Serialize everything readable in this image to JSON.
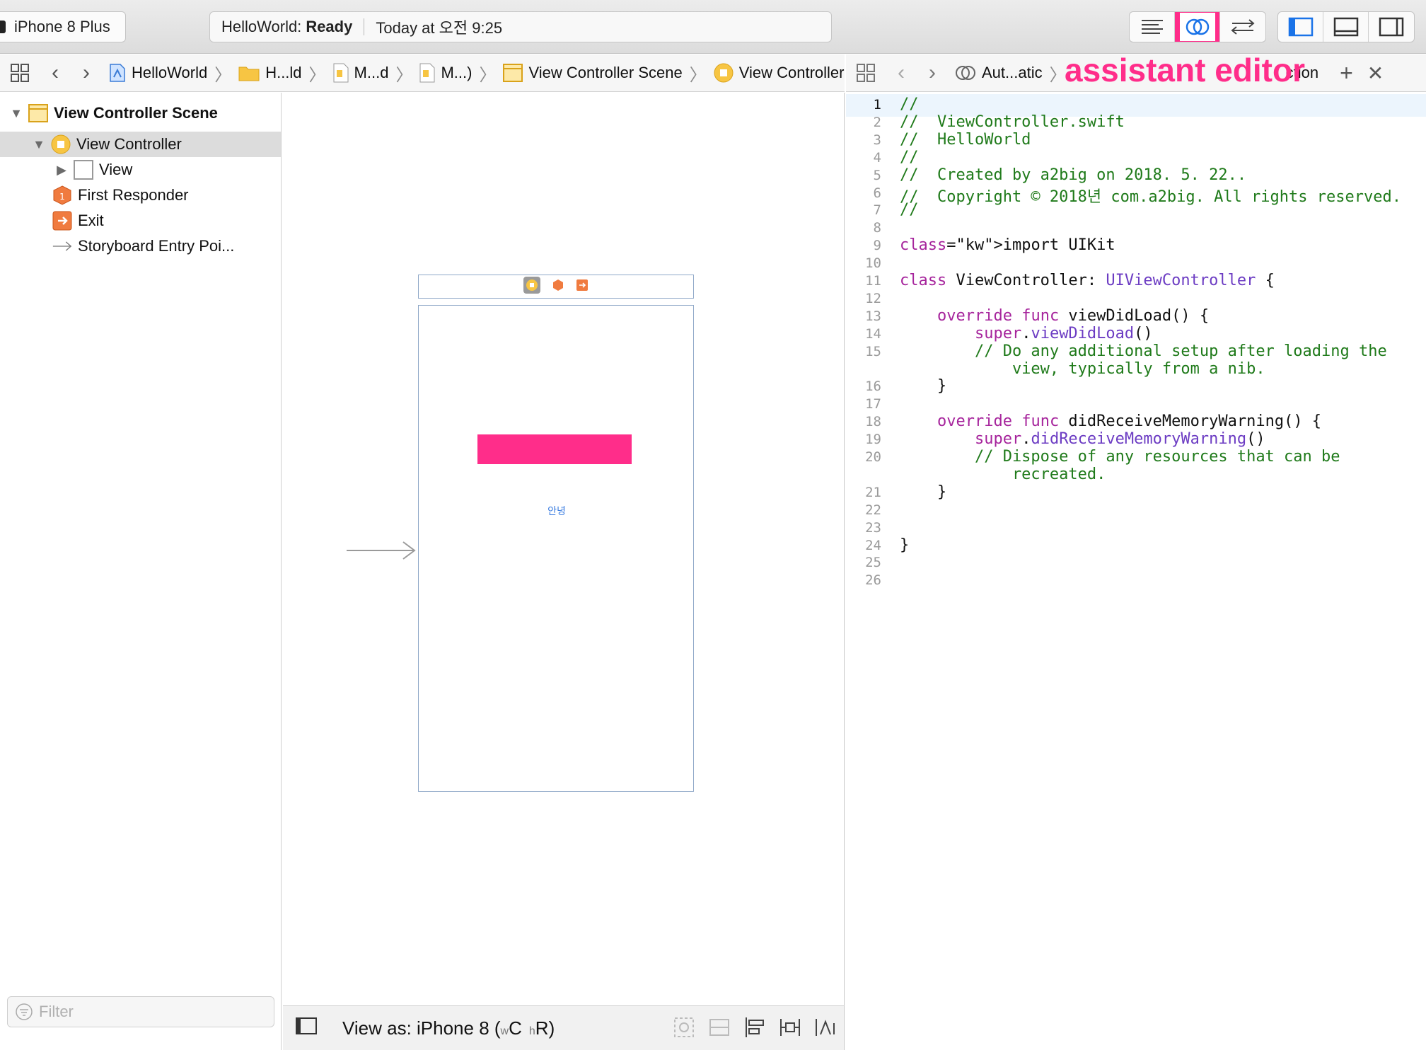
{
  "toolbar": {
    "scheme_device": "iPhone 8 Plus",
    "activity_app": "HelloWorld:",
    "activity_status": "Ready",
    "activity_time": "Today at 오전 9:25",
    "editor_buttons": [
      "standard-editor",
      "assistant-editor",
      "version-editor"
    ],
    "view_buttons": [
      "navigator",
      "debug-area",
      "utilities"
    ],
    "highlight_color": "#ff2d8a"
  },
  "jumpbar_left": {
    "crumbs": [
      "HelloWorld",
      "H...ld",
      "M...d",
      "M...)",
      "View Controller Scene",
      "View Controller"
    ]
  },
  "jumpbar_right": {
    "mode": "Aut...atic",
    "annotation_text": "assistant editor",
    "tail": "ction"
  },
  "outline": {
    "items": [
      {
        "label": "View Controller Scene"
      },
      {
        "label": "View Controller"
      },
      {
        "label": "View"
      },
      {
        "label": "First Responder"
      },
      {
        "label": "Exit"
      },
      {
        "label": "Storyboard Entry Poi..."
      }
    ],
    "filter_placeholder": "Filter"
  },
  "canvas": {
    "label_text": "안녕",
    "view_as_prefix": "View as: iPhone 8 (",
    "w_small": "w",
    "w_big": "C",
    "h_small": "h",
    "h_big": "R)",
    "pink_color": "#ff2d8a"
  },
  "code": {
    "lines": [
      {
        "n": "1",
        "t": "//"
      },
      {
        "n": "2",
        "t": "//  ViewController.swift"
      },
      {
        "n": "3",
        "t": "//  HelloWorld"
      },
      {
        "n": "4",
        "t": "//"
      },
      {
        "n": "5",
        "t": "//  Created by a2big on 2018. 5. 22.."
      },
      {
        "n": "6",
        "t": "//  Copyright © 2018년 com.a2big. All rights reserved."
      },
      {
        "n": "7",
        "t": "//"
      },
      {
        "n": "8",
        "t": ""
      },
      {
        "n": "9",
        "t": "import UIKit"
      },
      {
        "n": "10",
        "t": ""
      },
      {
        "n": "11",
        "t": "class ViewController: UIViewController {"
      },
      {
        "n": "12",
        "t": ""
      },
      {
        "n": "13",
        "t": "    override func viewDidLoad() {"
      },
      {
        "n": "14",
        "t": "        super.viewDidLoad()"
      },
      {
        "n": "15",
        "t": "        // Do any additional setup after loading the"
      },
      {
        "n": "",
        "t": "            view, typically from a nib."
      },
      {
        "n": "16",
        "t": "    }"
      },
      {
        "n": "17",
        "t": ""
      },
      {
        "n": "18",
        "t": "    override func didReceiveMemoryWarning() {"
      },
      {
        "n": "19",
        "t": "        super.didReceiveMemoryWarning()"
      },
      {
        "n": "20",
        "t": "        // Dispose of any resources that can be"
      },
      {
        "n": "",
        "t": "            recreated."
      },
      {
        "n": "21",
        "t": "    }"
      },
      {
        "n": "22",
        "t": ""
      },
      {
        "n": "23",
        "t": ""
      },
      {
        "n": "24",
        "t": "}"
      },
      {
        "n": "25",
        "t": ""
      },
      {
        "n": "26",
        "t": ""
      }
    ]
  }
}
